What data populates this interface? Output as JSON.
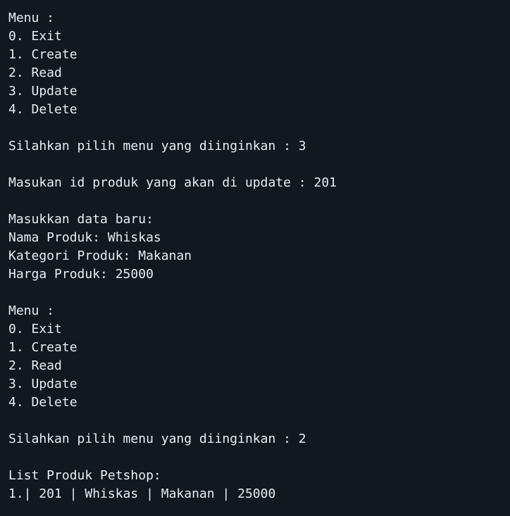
{
  "terminal": {
    "lines": [
      "Menu :",
      "0. Exit",
      "1. Create",
      "2. Read",
      "3. Update",
      "4. Delete",
      "",
      "Silahkan pilih menu yang diinginkan : 3",
      "",
      "Masukan id produk yang akan di update : 201",
      "",
      "Masukkan data baru:",
      "Nama Produk: Whiskas",
      "Kategori Produk: Makanan",
      "Harga Produk: 25000",
      "",
      "Menu :",
      "0. Exit",
      "1. Create",
      "2. Read",
      "3. Update",
      "4. Delete",
      "",
      "Silahkan pilih menu yang diinginkan : 2",
      "",
      "List Produk Petshop:",
      "1.| 201 | Whiskas | Makanan | 25000"
    ]
  }
}
